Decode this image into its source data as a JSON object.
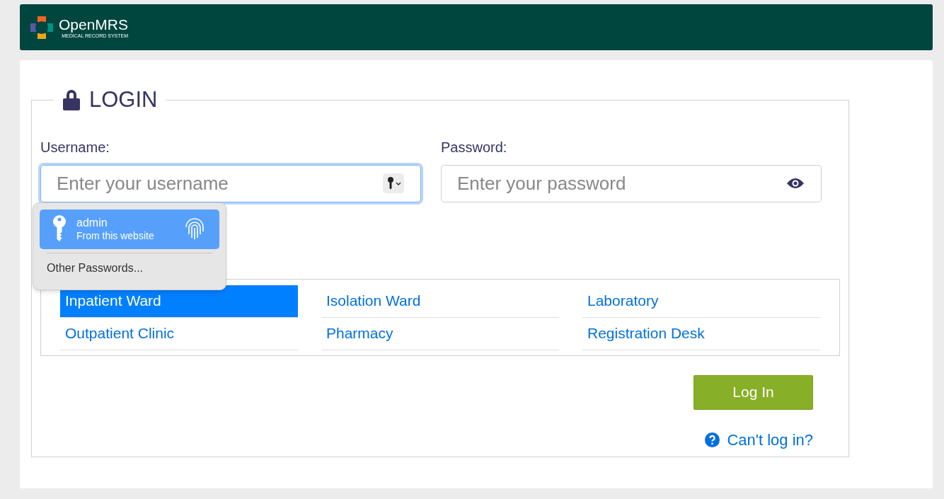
{
  "header": {
    "logo": {
      "name": "OpenMRS",
      "tagline": "MEDICAL RECORD SYSTEM"
    }
  },
  "login": {
    "title": "LOGIN",
    "username": {
      "label": "Username:",
      "placeholder": "Enter your username",
      "focused": true
    },
    "password": {
      "label": "Password:",
      "placeholder": "Enter your password"
    },
    "locations": [
      {
        "label": "Inpatient Ward",
        "selected": true
      },
      {
        "label": "Isolation Ward",
        "selected": false
      },
      {
        "label": "Laboratory",
        "selected": false
      },
      {
        "label": "Outpatient Clinic",
        "selected": false
      },
      {
        "label": "Pharmacy",
        "selected": false
      },
      {
        "label": "Registration Desk",
        "selected": false
      }
    ],
    "login_button": "Log In",
    "help_link": "Can't log in?"
  },
  "autofill_popup": {
    "entries": [
      {
        "username": "admin",
        "source": "From this website",
        "selected": true
      }
    ],
    "other": "Other Passwords..."
  }
}
